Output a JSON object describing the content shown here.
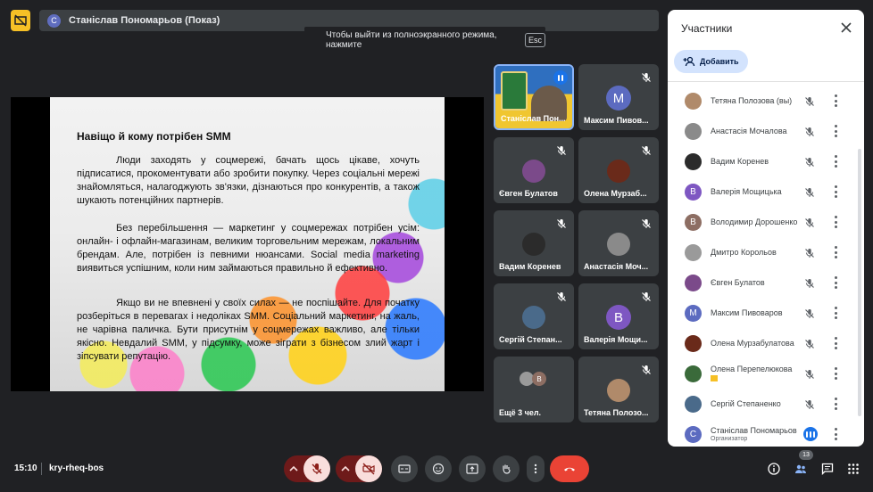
{
  "presenter_bar": {
    "avatar_letter": "С",
    "name": "Станіслав Пономарьов (Показ)"
  },
  "esc_hint": {
    "text": "Чтобы выйти из полноэкранного режима, нажмите",
    "key": "Esc"
  },
  "slide": {
    "title": "Навіщо й кому потрібен SMM",
    "paragraphs": [
      "Люди заходять у соцмережі, бачать щось цікаве, хочуть підписатися, прокоментувати або зробити покупку. Через соціальні мережі знайомляться, налагоджують зв'язки, дізнаються про конкурентів, а також шукають потенційних партнерів.",
      "Без перебільшення — маркетинг у соцмережах потрібен усім: онлайн- і офлайн-магазинам, великим торговельним мережам, локальним брендам. Але, потрібен із певними нюансами. Social media marketing виявиться успішним, коли ним займаються правильно й ефективно.",
      "Якщо ви не впевнені у своїх силах — не поспішайте. Для початку розберіться в перевагах і недоліках SMM. Соціальний маркетинг, на жаль, не чарівна паличка. Бути присутнім у соцмережах важливо, але тільки якісно. Невдалий SMM, у підсумку, може зіграти з бізнесом злий жарт і зіпсувати репутацію."
    ]
  },
  "tiles": [
    {
      "name": "Станіслав Пон...",
      "kind": "camera",
      "talking": true
    },
    {
      "name": "Максим Пивов...",
      "kind": "letter",
      "letter": "M",
      "color": "#5c6bc0"
    },
    {
      "name": "Євген Булатов",
      "kind": "photo",
      "color": "#7b4a8a"
    },
    {
      "name": "Олена Мурзаб...",
      "kind": "photo",
      "color": "#6a2a1a"
    },
    {
      "name": "Вадим Коренев",
      "kind": "photo",
      "color": "#2b2b2b"
    },
    {
      "name": "Анастасія Моч...",
      "kind": "photo",
      "color": "#8a8a8a"
    },
    {
      "name": "Сергій Степан...",
      "kind": "photo",
      "color": "#4a6a8a"
    },
    {
      "name": "Валерія Мощи...",
      "kind": "letter",
      "letter": "B",
      "color": "#7e57c2"
    },
    {
      "name": "Ещё 3 чел.",
      "kind": "more",
      "letter": "B"
    },
    {
      "name": "Тетяна Полозо...",
      "kind": "photo",
      "color": "#b08a6a"
    }
  ],
  "panel": {
    "title": "Участники",
    "add_label": "Добавить",
    "participants": [
      {
        "name": "Тетяна Полозова (вы)",
        "kind": "photo",
        "color": "#b08a6a"
      },
      {
        "name": "Анастасія Мочалова",
        "kind": "photo",
        "color": "#8a8a8a"
      },
      {
        "name": "Вадим Коренев",
        "kind": "photo",
        "color": "#2b2b2b"
      },
      {
        "name": "Валерія Мощицька",
        "kind": "letter",
        "letter": "B",
        "color": "#7e57c2"
      },
      {
        "name": "Володимир Дорошенко",
        "kind": "letter",
        "letter": "B",
        "color": "#8d6e63"
      },
      {
        "name": "Дмитро Корольов",
        "kind": "photo",
        "color": "#9a9a9a"
      },
      {
        "name": "Євген Булатов",
        "kind": "photo",
        "color": "#7b4a8a"
      },
      {
        "name": "Максим Пивоваров",
        "kind": "letter",
        "letter": "M",
        "color": "#5c6bc0"
      },
      {
        "name": "Олена Мурзабулатова",
        "kind": "photo",
        "color": "#6a2a1a"
      },
      {
        "name": "Олена Перепелюкова",
        "kind": "photo",
        "color": "#3a6a3a",
        "badge": true
      },
      {
        "name": "Сергій Степаненко",
        "kind": "photo",
        "color": "#4a6a8a"
      },
      {
        "name": "Станіслав Пономарьов",
        "sub": "Организатор",
        "kind": "letter",
        "letter": "С",
        "color": "#5c6bc0",
        "talking": true
      }
    ]
  },
  "bottom": {
    "time": "15:10",
    "meeting_code": "kry-rheq-bos",
    "participant_count": "13"
  },
  "colors": {
    "accent": "#1a73e8",
    "end_call": "#ea4335",
    "muted_bg": "#f9dedc"
  }
}
